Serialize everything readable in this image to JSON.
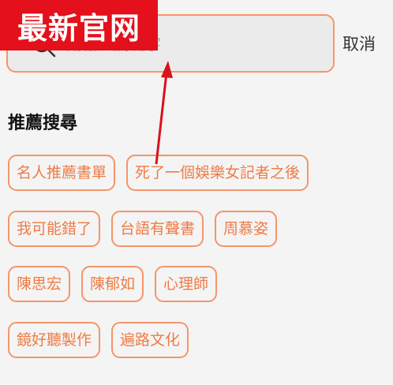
{
  "watermark": {
    "text": "最新官网"
  },
  "search": {
    "placeholder": "請輸入關鍵字",
    "icon": "search-icon",
    "cancel_label": "取消"
  },
  "recommended": {
    "title": "推薦搜尋",
    "rows": [
      [
        "名人推薦書單",
        "死了一個娛樂女記者之後"
      ],
      [
        "我可能錯了",
        "台語有聲書",
        "周慕姿"
      ],
      [
        "陳思宏",
        "陳郁如",
        "心理師"
      ],
      [
        "鏡好聽製作",
        "遍路文化"
      ]
    ]
  },
  "colors": {
    "accent": "#ef7b45",
    "border": "#f5956a",
    "watermark_bg": "#e4101b",
    "arrow": "#d9121c"
  }
}
